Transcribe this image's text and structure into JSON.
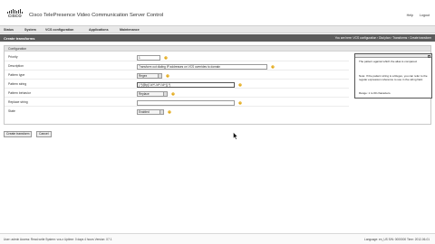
{
  "header": {
    "logo_text": "CISCO",
    "app_title": "Cisco TelePresence Video Communication Server Control",
    "links": [
      "Help",
      "Logout"
    ]
  },
  "nav": {
    "items": [
      "Status",
      "System",
      "VCS configuration",
      "Applications",
      "Maintenance"
    ]
  },
  "titlebar": {
    "title": "Create transforms",
    "breadcrumb": "You are here: VCS configuration › Dial plan › Transforms › Create transform"
  },
  "panel": {
    "heading": "Configuration",
    "rows": [
      {
        "label": "Priority",
        "value": "1",
        "kind": "text"
      },
      {
        "label": "Description",
        "value": "Transform out dialing IP addresses on VCS overrides to domain",
        "kind": "text"
      },
      {
        "label": "Pattern type",
        "value": "Regex",
        "kind": "select"
      },
      {
        "label": "Pattern string",
        "value": "(.*)@ip(\\.\\d+\\.\\d+\\.\\d+)(.*)",
        "kind": "text"
      },
      {
        "label": "Pattern behavior",
        "value": "Replace",
        "kind": "select"
      },
      {
        "label": "Replace string",
        "value": "",
        "kind": "text"
      },
      {
        "label": "State",
        "value": "Enabled",
        "kind": "select"
      }
    ]
  },
  "help_box": {
    "p1": "The pattern against which the alias is compared.",
    "p2": "Note: If the pattern string is a Regex, you can refer to the regular expression reference to use in the string field.",
    "p3": "Range: 1 to 60 characters."
  },
  "buttons": {
    "create": "Create transform",
    "cancel": "Cancel"
  },
  "footer": {
    "left": "User: admin  Access: Read-write  System: vcs-x  Uptime: 0 days 4 hours  Version: X7.1",
    "right": "Language: en_US  S/N: 0000000  Time: 2012-06-01"
  },
  "colors": {
    "titlebar": "#5b5b5b",
    "navbar": "#e8e8e8",
    "accent_help": "#e0a000"
  }
}
